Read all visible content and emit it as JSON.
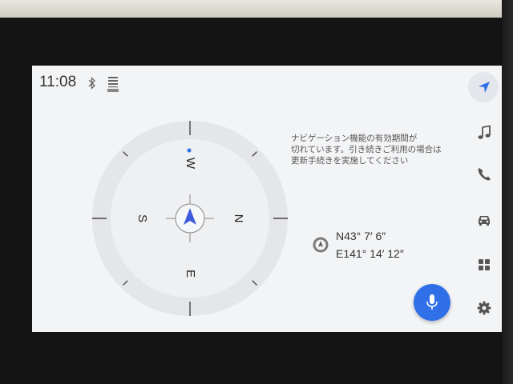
{
  "status_bar": {
    "time": "11:08",
    "icons": [
      "bluetooth-icon",
      "dcm-icon"
    ]
  },
  "compass": {
    "labels": {
      "n": "N",
      "s": "S",
      "e": "E",
      "w": "W"
    },
    "heading_marker_color": "#e53935",
    "north_dot_color": "#2f6fe8",
    "arrow_color": "#3b5bdb"
  },
  "message": {
    "lines": [
      "ナビゲーション機能の有効期間が",
      "切れています。引き続きご利用の場合は",
      "更新手続きを実施してください"
    ]
  },
  "location": {
    "latitude": "N43° 7′ 6″",
    "longitude": "E141° 14′ 12″"
  },
  "mic_button": {
    "color": "#2f6fe8",
    "icon": "microphone-icon"
  },
  "sidebar": {
    "items": [
      {
        "id": "navigation",
        "icon": "navigation-arrow-icon",
        "active": true
      },
      {
        "id": "music",
        "icon": "music-note-icon",
        "active": false
      },
      {
        "id": "phone",
        "icon": "phone-icon",
        "active": false
      },
      {
        "id": "vehicle",
        "icon": "car-icon",
        "active": false
      },
      {
        "id": "apps",
        "icon": "apps-grid-icon",
        "active": false
      },
      {
        "id": "settings",
        "icon": "gear-icon",
        "active": false
      }
    ],
    "accent_color": "#2f6fe8",
    "icon_color": "#555555"
  }
}
